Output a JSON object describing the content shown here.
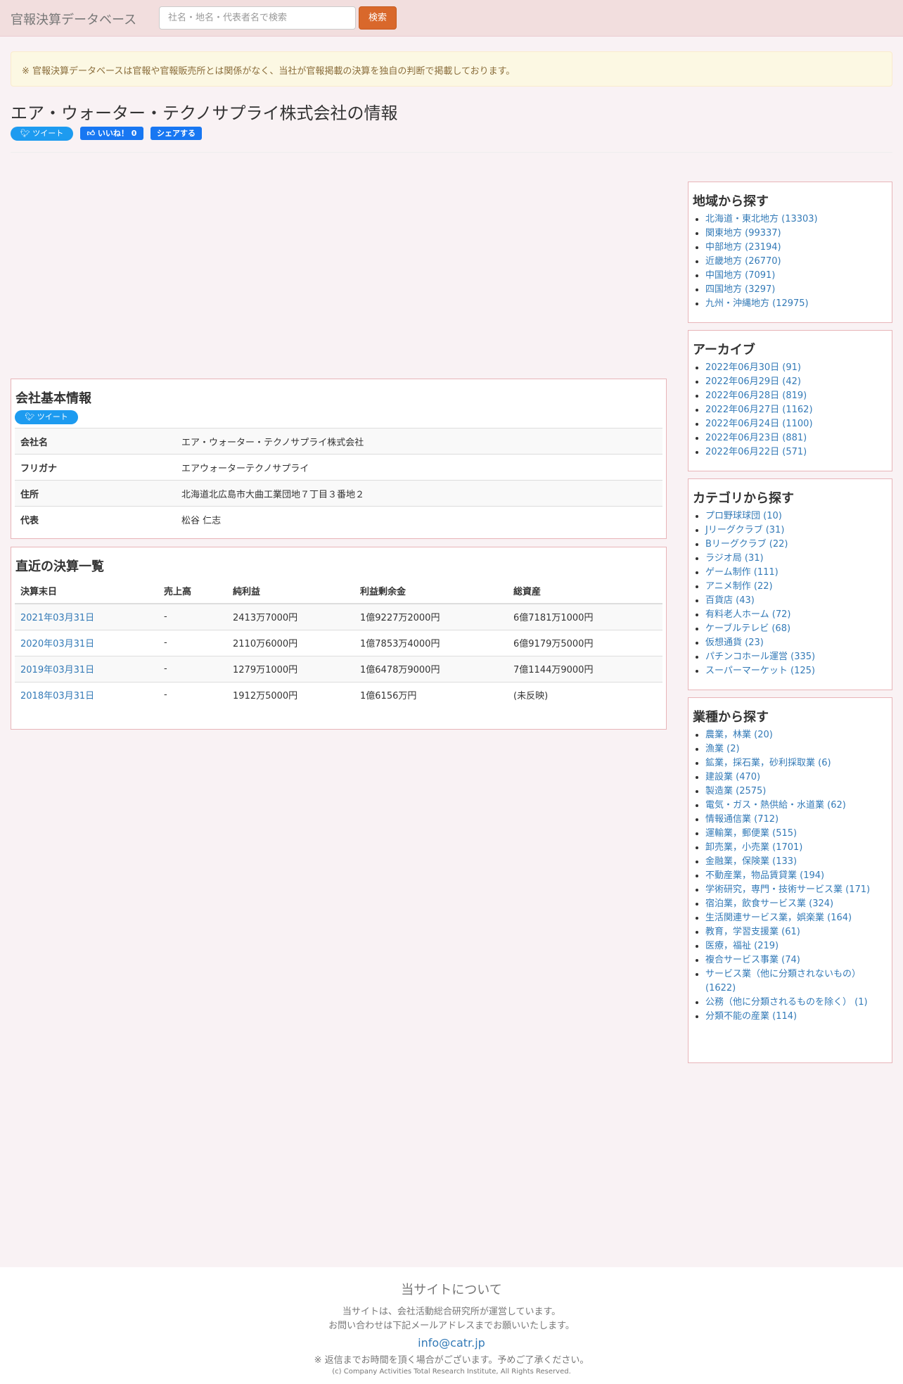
{
  "nav": {
    "brand": "官報決算データベース",
    "search_placeholder": "社名・地名・代表者名で検索",
    "search_button": "検索"
  },
  "notice": "※ 官報決算データベースは官報や官報販売所とは関係がなく、当社が官報掲載の決算を独自の判断で掲載しております。",
  "page_title": "エア・ウォーター・テクノサプライ株式会社の情報",
  "social": {
    "tweet": "ツイート",
    "like": "いいね！ 0",
    "share": "シェアする"
  },
  "company_info": {
    "title": "会社基本情報",
    "tweet": "ツイート",
    "rows": [
      {
        "key": "会社名",
        "value": "エア・ウォーター・テクノサプライ株式会社"
      },
      {
        "key": "フリガナ",
        "value": "エアウォーターテクノサプライ"
      },
      {
        "key": "住所",
        "value": "北海道北広島市大曲工業団地７丁目３番地２"
      },
      {
        "key": "代表",
        "value": "松谷 仁志"
      }
    ]
  },
  "results": {
    "title": "直近の決算一覧",
    "headers": [
      "決算末日",
      "売上高",
      "純利益",
      "利益剰余金",
      "総資産"
    ],
    "rows": [
      [
        "2021年03月31日",
        "-",
        "2413万7000円",
        "1億9227万2000円",
        "6億7181万1000円"
      ],
      [
        "2020年03月31日",
        "-",
        "2110万6000円",
        "1億7853万4000円",
        "6億9179万5000円"
      ],
      [
        "2019年03月31日",
        "-",
        "1279万1000円",
        "1億6478万9000円",
        "7億1144万9000円"
      ],
      [
        "2018年03月31日",
        "-",
        "1912万5000円",
        "1億6156万円",
        "(未反映)"
      ]
    ]
  },
  "sidebar": {
    "region": {
      "title": "地域から探す",
      "items": [
        "北海道・東北地方 (13303)",
        "関東地方 (99337)",
        "中部地方 (23194)",
        "近畿地方 (26770)",
        "中国地方 (7091)",
        "四国地方 (3297)",
        "九州・沖縄地方 (12975)"
      ]
    },
    "archive": {
      "title": "アーカイブ",
      "items": [
        "2022年06月30日 (91)",
        "2022年06月29日 (42)",
        "2022年06月28日 (819)",
        "2022年06月27日 (1162)",
        "2022年06月24日 (1100)",
        "2022年06月23日 (881)",
        "2022年06月22日 (571)"
      ]
    },
    "category": {
      "title": "カテゴリから探す",
      "items": [
        "プロ野球球団 (10)",
        "Jリーグクラブ (31)",
        "Bリーグクラブ (22)",
        "ラジオ局 (31)",
        "ゲーム制作 (111)",
        "アニメ制作 (22)",
        "百貨店 (43)",
        "有料老人ホーム (72)",
        "ケーブルテレビ (68)",
        "仮想通貨 (23)",
        "パチンコホール運営 (335)",
        "スーパーマーケット (125)"
      ]
    },
    "industry": {
      "title": "業種から探す",
      "items": [
        "農業，林業 (20)",
        "漁業 (2)",
        "鉱業，採石業，砂利採取業 (6)",
        "建設業 (470)",
        "製造業 (2575)",
        "電気・ガス・熱供給・水道業 (62)",
        "情報通信業 (712)",
        "運輸業，郵便業 (515)",
        "卸売業，小売業 (1701)",
        "金融業，保険業 (133)",
        "不動産業，物品賃貸業 (194)",
        "学術研究，専門・技術サービス業 (171)",
        "宿泊業，飲食サービス業 (324)",
        "生活関連サービス業，娯楽業 (164)",
        "教育，学習支援業 (61)",
        "医療，福祉 (219)",
        "複合サービス事業 (74)",
        "サービス業（他に分類されないもの） (1622)",
        "公務（他に分類されるものを除く） (1)",
        "分類不能の産業 (114)"
      ]
    }
  },
  "footer": {
    "title": "当サイトについて",
    "line1": "当サイトは、会社活動総合研究所が運営しています。",
    "line2": "お問い合わせは下記メールアドレスまでお願いいたします。",
    "email": "info@catr.jp",
    "note": "※ 返信までお時間を頂く場合がございます。予めご了承ください。",
    "copyright": "(c) Company Activities Total Research Institute, All Rights Reserved."
  }
}
